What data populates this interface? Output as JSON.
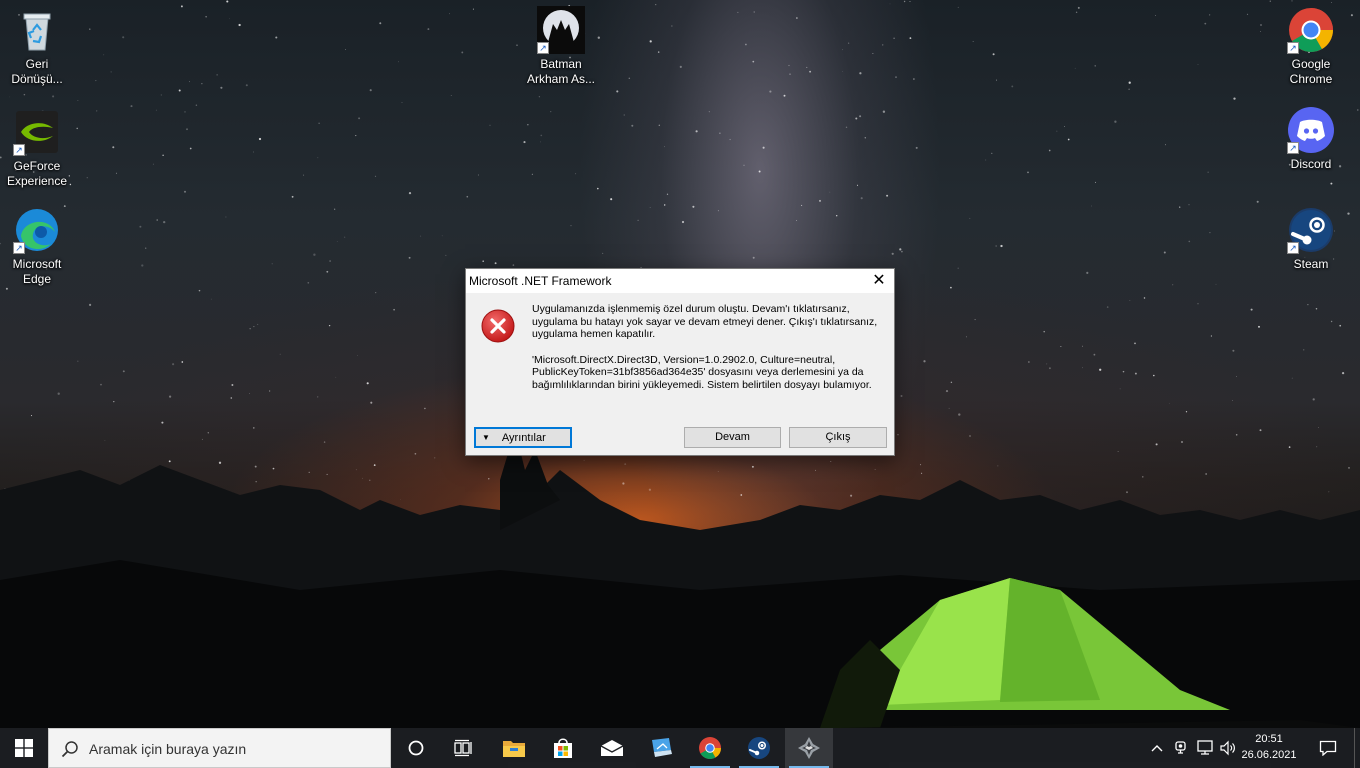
{
  "desktop": {
    "icons": [
      {
        "id": "recycle-bin",
        "label": "Geri\nDönüşü..."
      },
      {
        "id": "geforce",
        "label": "GeForce\nExperience"
      },
      {
        "id": "edge",
        "label": "Microsoft\nEdge"
      },
      {
        "id": "batman",
        "label": "Batman\nArkham As..."
      },
      {
        "id": "chrome",
        "label": "Google\nChrome"
      },
      {
        "id": "discord",
        "label": "Discord"
      },
      {
        "id": "steam",
        "label": "Steam"
      }
    ]
  },
  "dialog": {
    "title": "Microsoft .NET Framework",
    "close_symbol": "✕",
    "message_1": "Uygulamanızda işlenmemiş özel durum oluştu. Devam'ı tıklatırsanız, uygulama bu hatayı yok sayar ve devam etmeyi dener. Çıkış'ı tıklatırsanız, uygulama hemen kapatılır.",
    "message_2": "'Microsoft.DirectX.Direct3D, Version=1.0.2902.0, Culture=neutral, PublicKeyToken=31bf3856ad364e35' dosyasını veya derlemesini ya da bağımlılıklarından birini yükleyemedi. Sistem belirtilen dosyayı bulamıyor.",
    "details_label": "Ayrıntılar",
    "continue_label": "Devam",
    "quit_label": "Çıkış"
  },
  "taskbar": {
    "search_placeholder": "Aramak için buraya yazın",
    "clock_time": "20:51",
    "clock_date": "26.06.2021"
  },
  "colors": {
    "accent": "#0078d7",
    "error_red": "#d42020",
    "taskbar_bg": "#1c1e22",
    "dialog_bg": "#f0f0f0",
    "geforce_green": "#76b900",
    "discord_blurple": "#5865f2",
    "steam_blue": "#1b2838"
  },
  "icons": [
    "recycle-bin-icon",
    "geforce-icon",
    "edge-icon",
    "batman-icon",
    "chrome-icon",
    "discord-icon",
    "steam-icon",
    "error-icon",
    "close-icon",
    "windows-start-icon",
    "search-icon",
    "cortana-icon",
    "task-view-icon",
    "file-explorer-icon",
    "store-icon",
    "mail-icon",
    "network-app-icon",
    "chrome-taskbar-icon",
    "steam-taskbar-icon",
    "batman-taskbar-icon",
    "chevron-up-icon",
    "webcam-icon",
    "network-icon",
    "volume-icon",
    "notification-icon"
  ]
}
